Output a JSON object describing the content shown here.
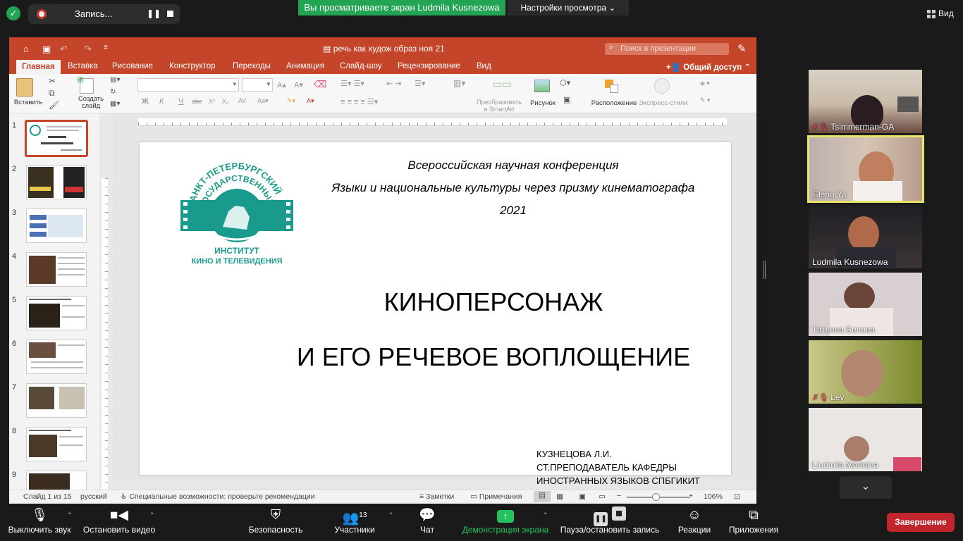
{
  "zoom_top": {
    "recording_label": "Запись...",
    "viewing_banner": "Вы просматриваете экран Ludmila Kusnezowa",
    "view_settings": "Настройки просмотра",
    "view_label": "Вид"
  },
  "ppt": {
    "doc_title": "речь как худож образ ноя 21",
    "search_placeholder": "Поиск в презентации",
    "share_label": "Общий доступ",
    "tabs": [
      "Главная",
      "Вставка",
      "Рисование",
      "Конструктор",
      "Переходы",
      "Анимация",
      "Слайд-шоу",
      "Рецензирование",
      "Вид"
    ],
    "ribbon": {
      "paste": "Вставить",
      "new_slide_1": "Создать",
      "new_slide_2": "слайд",
      "convert_smartart_1": "Преобразовать",
      "convert_smartart_2": "в SmartArt",
      "picture": "Рисунок",
      "arrange": "Расположение",
      "quick_styles": "Экспресс-стили"
    },
    "thumb_numbers": [
      "1",
      "2",
      "3",
      "4",
      "5",
      "6",
      "7",
      "8",
      "9"
    ],
    "slide": {
      "conf_line1": "Всероссийская научная конференция",
      "conf_line2": "Языки и национальные культуры через призму кинематографа",
      "conf_line3": "2021",
      "main_title_1": "КИНОПЕРСОНАЖ",
      "main_title_2": "И ЕГО РЕЧЕВОЕ ВОПЛОЩЕНИЕ",
      "author_1": "КУЗНЕЦОВА Л.И.",
      "author_2": "СТ.ПРЕПОДАВАТЕЛЬ КАФЕДРЫ",
      "author_3": "ИНОСТРАННЫХ ЯЗЫКОВ СПБГИКИТ",
      "logo": {
        "arc_top": "САНКТ-ПЕТЕРБУРГСКИЙ",
        "arc_bottom": "ГОСУДАРСТВЕННЫЙ",
        "line1": "ИНСТИТУТ",
        "line2": "КИНО И ТЕЛЕВИДЕНИЯ",
        "color": "#1a9a8c"
      }
    },
    "status": {
      "slide_of": "Слайд 1 из 15",
      "language": "русский",
      "accessibility": "Специальные возможности: проверьте рекомендации",
      "notes": "Заметки",
      "comments": "Примечания",
      "zoom": "106%"
    },
    "accent": "#c5452a"
  },
  "participants": [
    {
      "name": "Tsimmerman-GA",
      "muted": true
    },
    {
      "name": "Elena Ya",
      "muted": false,
      "active": true
    },
    {
      "name": "Ludmila Kusnezowa",
      "muted": false
    },
    {
      "name": "Татьяна Белова",
      "muted": false
    },
    {
      "name": "Lev",
      "muted": true
    },
    {
      "name": "Liudmila Marinina",
      "muted": false
    }
  ],
  "toolbar": {
    "mute": "Выключить звук",
    "video": "Остановить видео",
    "security": "Безопасность",
    "participants": "Участники",
    "participants_count": "13",
    "chat": "Чат",
    "share": "Демонстрация экрана",
    "pause_record": "Пауза/остановить запись",
    "reactions": "Реакции",
    "apps": "Приложения",
    "end": "Завершение"
  }
}
